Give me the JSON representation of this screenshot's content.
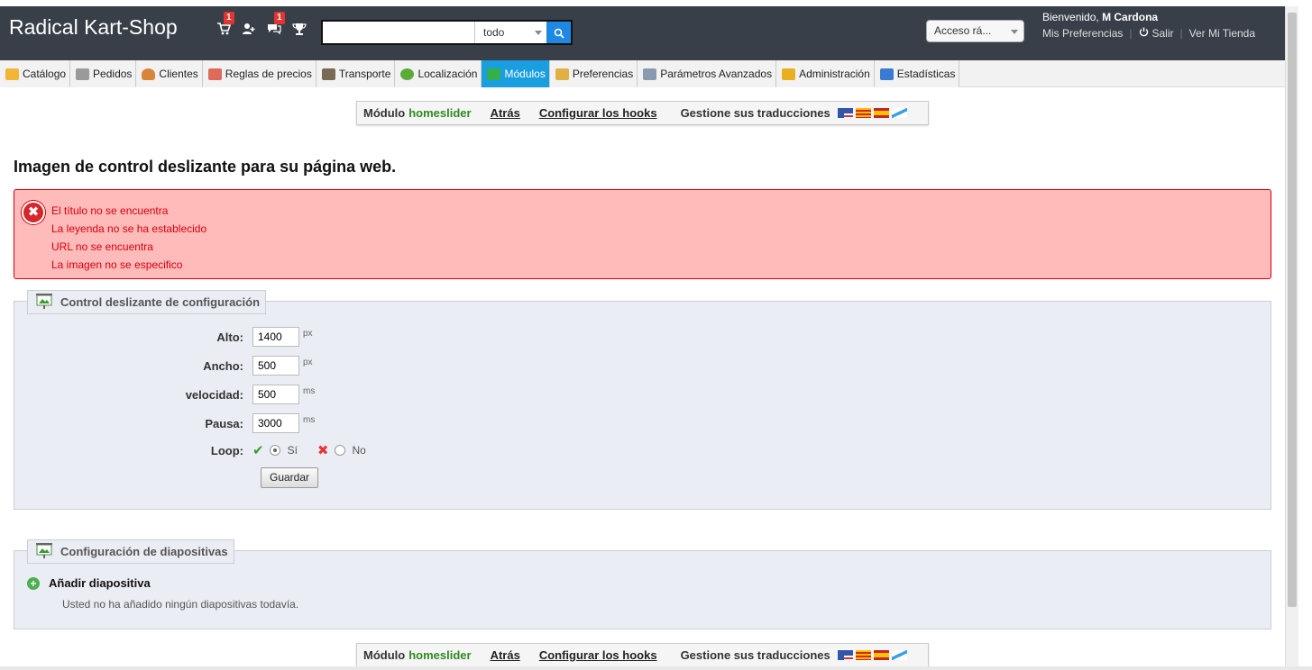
{
  "header": {
    "brand": "Radical Kart-Shop",
    "badges": {
      "cart": "1",
      "messages": "1"
    },
    "search_value": "",
    "search_scope": "todo",
    "quick_access": "Acceso rá...",
    "welcome_prefix": "Bienvenido,",
    "user_name": "M Cardona",
    "my_preferences": "Mis Preferencias",
    "logout": "Salir",
    "view_store": "Ver Mi Tienda"
  },
  "tabs": [
    {
      "label": "Catálogo",
      "color": "#f2b536"
    },
    {
      "label": "Pedidos",
      "color": "#8a8a8a"
    },
    {
      "label": "Clientes",
      "color": "#d9843b"
    },
    {
      "label": "Reglas de precios",
      "color": "#e06a5a"
    },
    {
      "label": "Transporte",
      "color": "#7a6a55"
    },
    {
      "label": "Localización",
      "color": "#5bab3a"
    },
    {
      "label": "Módulos",
      "color": "#34b04a"
    },
    {
      "label": "Preferencias",
      "color": "#e0b040"
    },
    {
      "label": "Parámetros Avanzados",
      "color": "#8a9ab0"
    },
    {
      "label": "Administración",
      "color": "#e8b020"
    },
    {
      "label": "Estadísticas",
      "color": "#3a7ad0"
    }
  ],
  "toolbar": {
    "module_prefix": "Módulo",
    "module_name": "homeslider",
    "back": "Atrás",
    "hooks": "Configurar los hooks",
    "translations": "Gestione sus traducciones"
  },
  "page_title": "Imagen de control deslizante para su página web.",
  "errors": [
    "El título no se encuentra",
    "La leyenda no se ha establecido",
    "URL no se encuentra",
    "La imagen no se especifico"
  ],
  "config": {
    "legend": "Control deslizante de configuración",
    "fields": [
      {
        "label": "Alto:",
        "value": "1400",
        "unit": "px"
      },
      {
        "label": "Ancho:",
        "value": "500",
        "unit": "px"
      },
      {
        "label": "velocidad:",
        "value": "500",
        "unit": "ms"
      },
      {
        "label": "Pausa:",
        "value": "3000",
        "unit": "ms"
      }
    ],
    "loop_label": "Loop:",
    "loop_yes": "Sí",
    "loop_no": "No",
    "save": "Guardar"
  },
  "slides": {
    "legend": "Configuración de diapositivas",
    "add": "Añadir diapositiva",
    "empty": "Usted no ha añadido ningún diapositivas todavía."
  }
}
